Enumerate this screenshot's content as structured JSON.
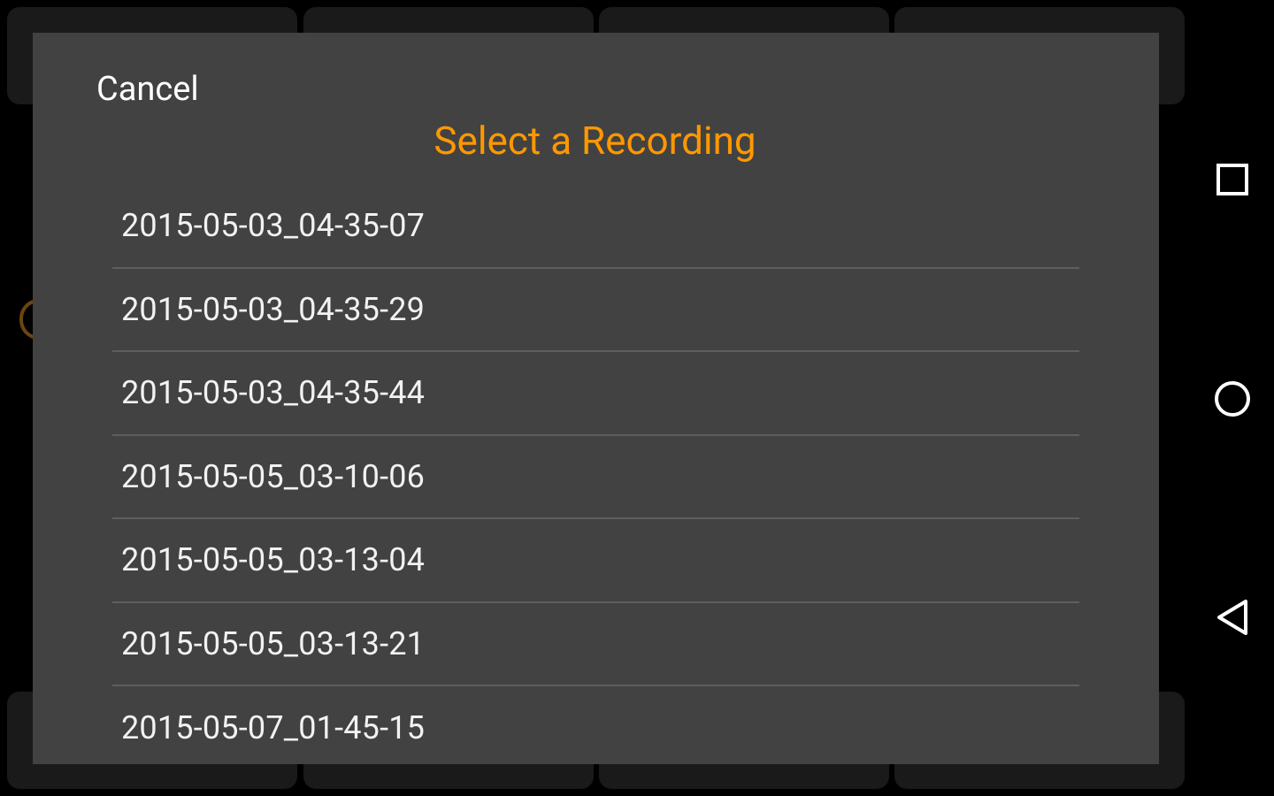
{
  "dialog": {
    "cancel_label": "Cancel",
    "title": "Select a Recording",
    "recordings": [
      "2015-05-03_04-35-07",
      "2015-05-03_04-35-29",
      "2015-05-03_04-35-44",
      "2015-05-05_03-10-06",
      "2015-05-05_03-13-04",
      "2015-05-05_03-13-21",
      "2015-05-07_01-45-15"
    ]
  },
  "navbar": {
    "buttons": [
      {
        "icon": "recents-square-icon"
      },
      {
        "icon": "home-circle-icon"
      },
      {
        "icon": "back-triangle-icon"
      }
    ]
  },
  "colors": {
    "dialog_background": "#424242",
    "title_accent": "#ff9800",
    "text": "#ffffff",
    "divider": "#5e5e5e"
  }
}
